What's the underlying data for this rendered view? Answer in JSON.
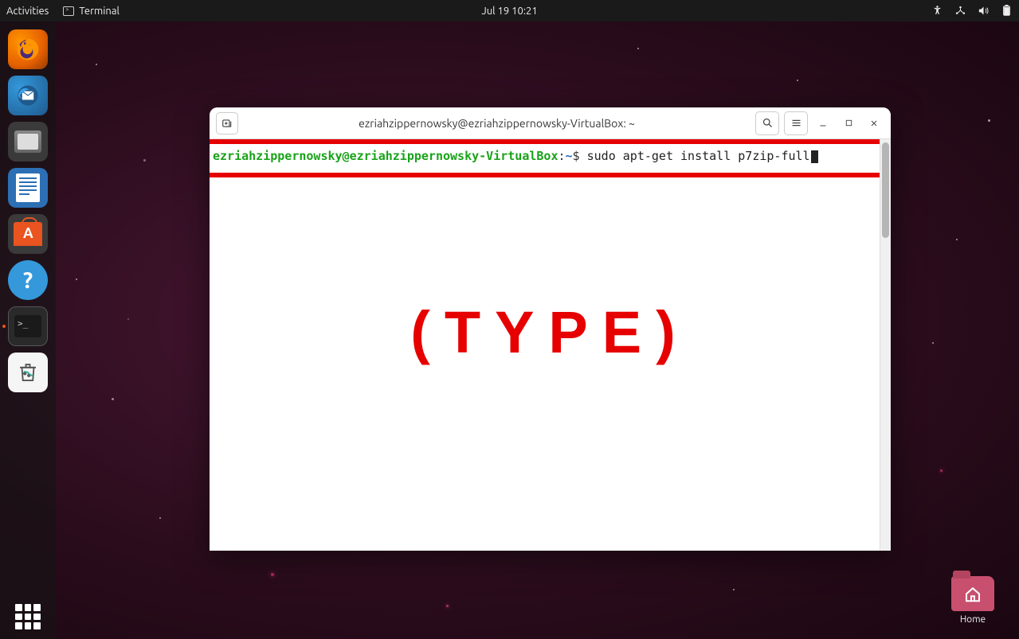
{
  "topbar": {
    "activities": "Activities",
    "app_label": "Terminal",
    "datetime": "Jul 19  10:21"
  },
  "dock": {
    "items": [
      "firefox",
      "thunderbird",
      "files",
      "writer",
      "software",
      "help",
      "terminal",
      "trash"
    ]
  },
  "terminal": {
    "title": "ezriahzippernowsky@ezriahzippernowsky-VirtualBox: ~",
    "prompt_user_host": "ezriahzippernowsky@ezriahzippernowsky-VirtualBox",
    "prompt_path": "~",
    "command": "sudo apt-get install p7zip-full",
    "overlay_text": "(TYPE)"
  },
  "desktop": {
    "home_label": "Home"
  }
}
